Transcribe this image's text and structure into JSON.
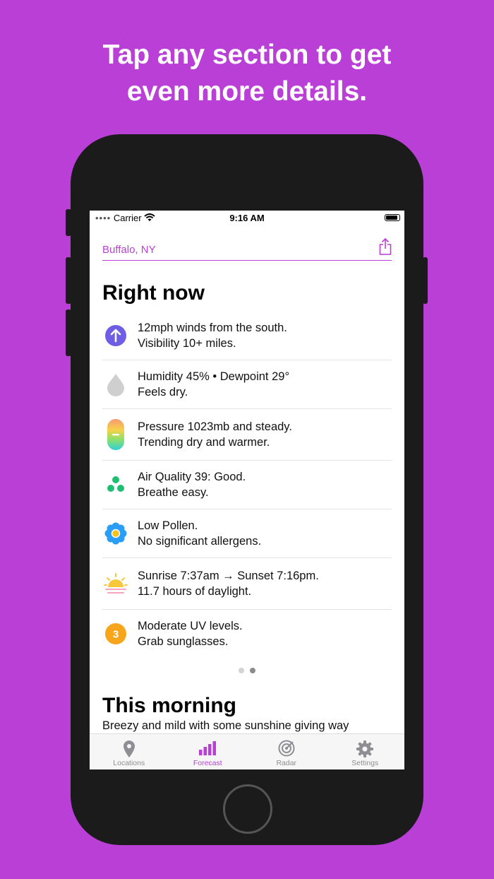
{
  "promo": {
    "line1": "Tap any section to get",
    "line2": "even more details."
  },
  "status_bar": {
    "carrier": "Carrier",
    "time": "9:16 AM"
  },
  "header": {
    "location": "Buffalo, NY"
  },
  "right_now": {
    "title": "Right now",
    "items": [
      {
        "icon": "wind-arrow-icon",
        "line1": "12mph winds from the south.",
        "line2": "Visibility 10+ miles."
      },
      {
        "icon": "humidity-drop-icon",
        "line1": "Humidity 45% • Dewpoint 29°",
        "line2": "Feels dry."
      },
      {
        "icon": "pressure-gauge-icon",
        "line1": "Pressure 1023mb and steady.",
        "line2": "Trending dry and warmer."
      },
      {
        "icon": "air-quality-icon",
        "line1": "Air Quality 39: Good.",
        "line2": "Breathe easy."
      },
      {
        "icon": "pollen-flower-icon",
        "line1": "Low Pollen.",
        "line2": "No significant allergens."
      },
      {
        "icon": "sunrise-icon",
        "line1": "Sunrise 7:37am → Sunset 7:16pm.",
        "line2": "11.7 hours of daylight."
      },
      {
        "icon": "uv-index-icon",
        "line1": "Moderate UV levels.",
        "line2": "Grab sunglasses.",
        "badge": "3"
      }
    ],
    "page_count": 2,
    "current_page": 2
  },
  "this_morning": {
    "title": "This morning",
    "summary": "Breezy and mild with some sunshine giving way"
  },
  "tabs": [
    {
      "label": "Locations",
      "icon": "map-pin-icon"
    },
    {
      "label": "Forecast",
      "icon": "bar-chart-icon",
      "active": true
    },
    {
      "label": "Radar",
      "icon": "radar-icon"
    },
    {
      "label": "Settings",
      "icon": "gear-icon"
    }
  ],
  "colors": {
    "brand": "#b93fd7",
    "wind": "#6e5ee6",
    "air_quality": "#1fbf73",
    "pollen": "#2a9df4",
    "uv": "#f7a51b"
  }
}
